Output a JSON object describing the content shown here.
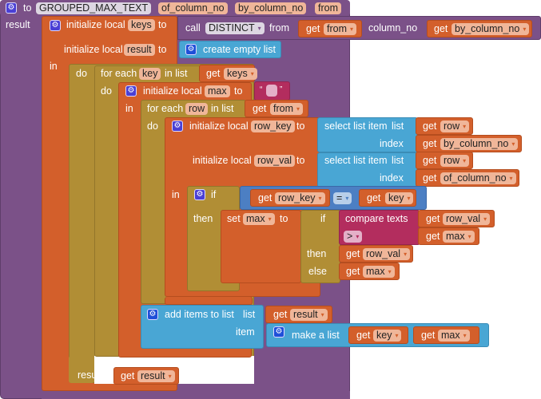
{
  "procedure": {
    "keyword_to": "to",
    "name": "GROUPED_MAX_TEXT",
    "params": [
      "of_column_no",
      "by_column_no",
      "from"
    ],
    "result_label": "result"
  },
  "init_keys": {
    "label": "initialize local",
    "var": "keys",
    "to": "to",
    "call": "call",
    "func": "DISTINCT",
    "from_label": "from",
    "get": "get",
    "from_var": "from",
    "column_no_label": "column_no",
    "column_var": "by_column_no"
  },
  "init_result": {
    "label": "initialize local",
    "var": "result",
    "to": "to",
    "value": "create empty list"
  },
  "in_label": "in",
  "do_label": "do",
  "foreach_key": {
    "label": "for each",
    "var": "key",
    "in_list": "in list",
    "get": "get",
    "list_var": "keys"
  },
  "init_max": {
    "label": "initialize local",
    "var": "max",
    "to": "to",
    "quote_open": "“",
    "quote_close": "”"
  },
  "foreach_row": {
    "label": "for each",
    "var": "row",
    "in_list": "in list",
    "get": "get",
    "list_var": "from"
  },
  "init_row_key": {
    "label": "initialize local",
    "var": "row_key",
    "to": "to",
    "select": "select list item",
    "list_label": "list",
    "index_label": "index",
    "get": "get",
    "list_var": "row",
    "index_var": "by_column_no"
  },
  "init_row_val": {
    "label": "initialize local",
    "var": "row_val",
    "to": "to",
    "select": "select list item",
    "list_label": "list",
    "index_label": "index",
    "get": "get",
    "list_var": "row",
    "index_var": "of_column_no"
  },
  "if_block": {
    "if_label": "if",
    "then_label": "then",
    "get": "get",
    "left_var": "row_key",
    "op": "=",
    "right_var": "key"
  },
  "set_max": {
    "set": "set",
    "var": "max",
    "to": "to",
    "if": "if",
    "then": "then",
    "else": "else",
    "compare": "compare texts",
    "op": ">",
    "get": "get",
    "cmp_a": "row_val",
    "cmp_b": "max",
    "then_var": "row_val",
    "else_var": "max"
  },
  "add_items": {
    "label": "add items to list",
    "list_label": "list",
    "item_label": "item",
    "get": "get",
    "list_var": "result",
    "make_list": "make a list",
    "item_a": "key",
    "item_b": "max"
  },
  "final_result": {
    "label": "result",
    "get": "get",
    "var": "result"
  }
}
